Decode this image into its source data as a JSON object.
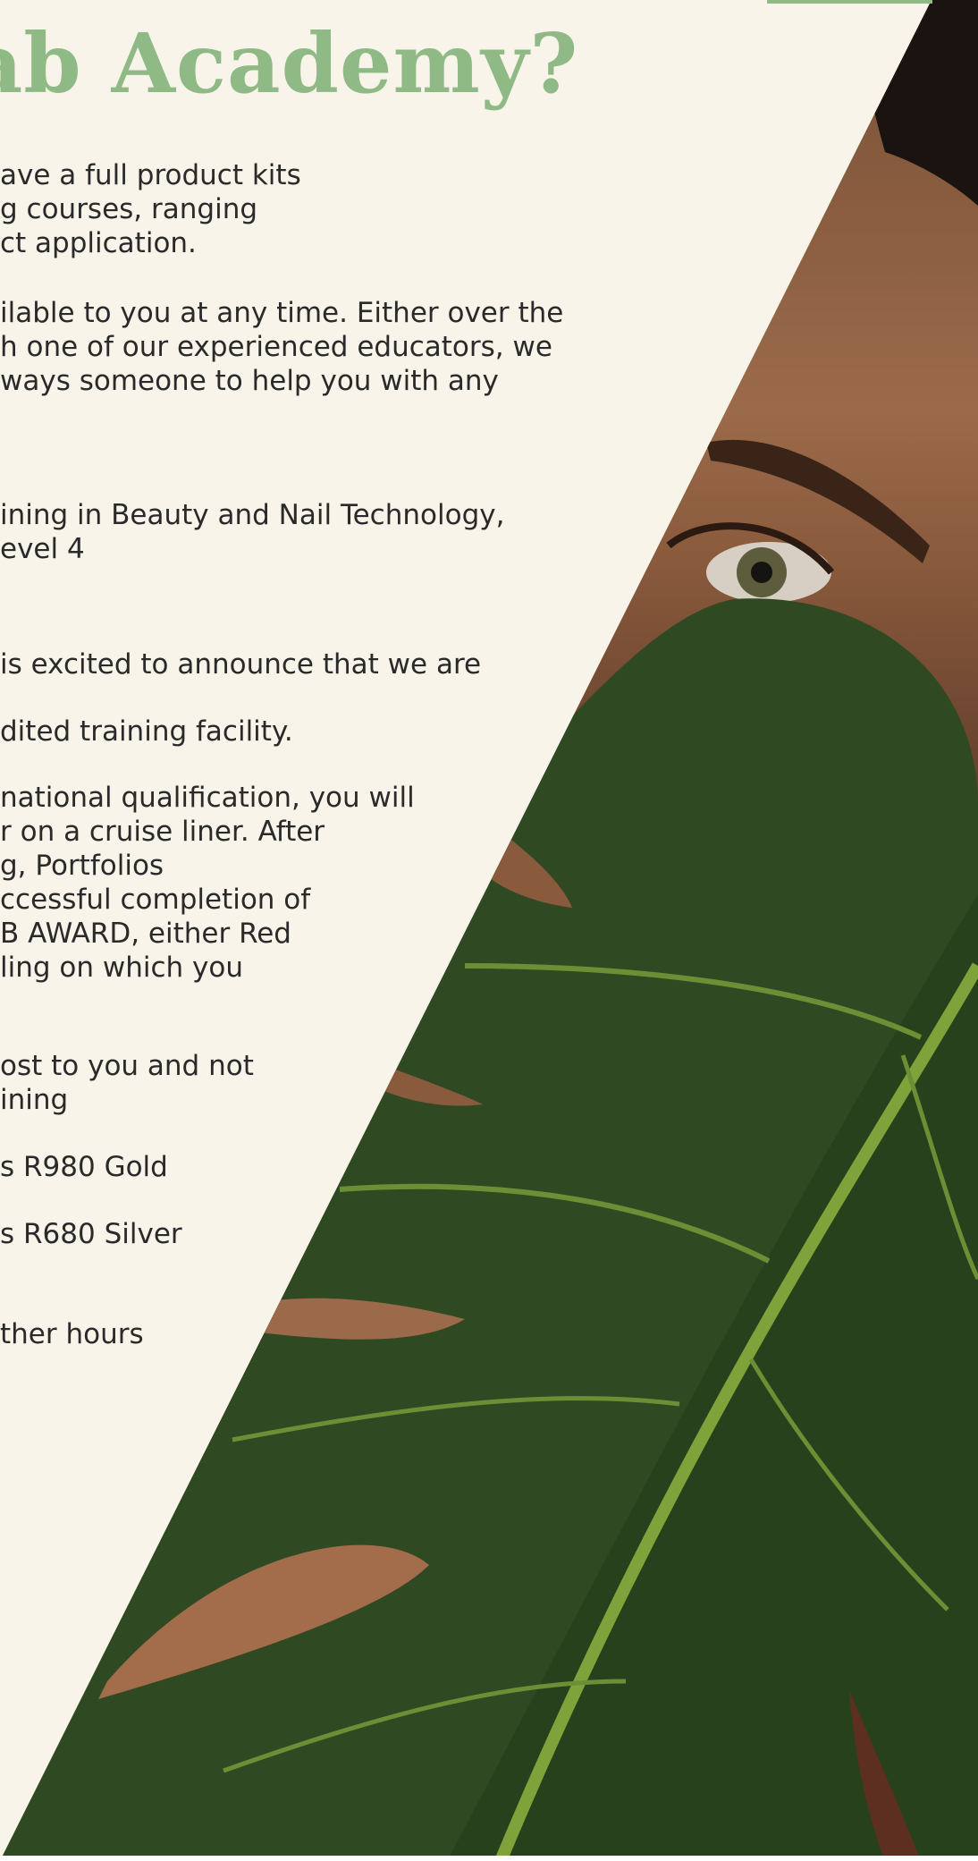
{
  "page": {
    "heading": "Lab Academy?",
    "colors": {
      "background": "#f8f4ea",
      "heading": "#8fba86",
      "body_text": "#2a2a2a",
      "accent_bar": "#8fba86",
      "leaf": "#2f4a23"
    },
    "paragraphs": [
      {
        "id": "kits",
        "lines": [
          "ave a full product kits",
          "g courses, ranging",
          "ct application."
        ]
      },
      {
        "id": "support",
        "lines": [
          "ilable to you at any time. Either over the",
          "h one of our experienced educators, we",
          "ways someone to help you with any"
        ]
      },
      {
        "id": "training",
        "lines": [
          "ining in Beauty and Nail Technology,",
          "evel 4"
        ]
      },
      {
        "id": "announce",
        "lines": [
          "is excited to announce that we are"
        ]
      },
      {
        "id": "facility",
        "lines": [
          "dited training facility."
        ]
      },
      {
        "id": "qualification",
        "lines": [
          "national qualification, you will",
          "r on a cruise liner. After",
          "g, Portfolios",
          "ccessful completion of",
          "B AWARD, either Red",
          "ling on which you"
        ]
      },
      {
        "id": "cost",
        "lines": [
          "ost to you and not",
          "ining"
        ]
      },
      {
        "id": "gold",
        "lines": [
          "s R980 Gold"
        ]
      },
      {
        "id": "silver",
        "lines": [
          "s R680 Silver"
        ]
      },
      {
        "id": "hours",
        "lines": [
          "ther hours"
        ]
      }
    ],
    "image": {
      "icon": "woman-with-monstera-leaf-photo"
    }
  }
}
